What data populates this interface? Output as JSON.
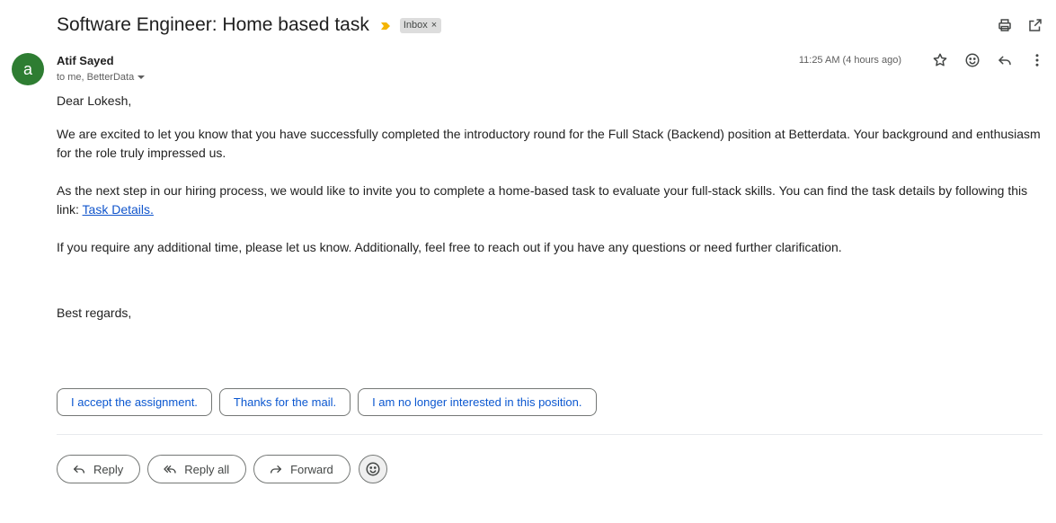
{
  "email": {
    "subject": "Software Engineer: Home based task",
    "label": "Inbox",
    "sender": {
      "name": "Atif Sayed",
      "avatar_letter": "a",
      "avatar_color": "#2e7d32"
    },
    "recipients": "to me, BetterData",
    "timestamp": "11:25 AM (4 hours ago)",
    "body": {
      "greeting": "Dear Lokesh,",
      "paragraph1": "We are excited to let you know that you have successfully completed the introductory round for the Full Stack (Backend) position at Betterdata. Your background and enthusiasm for the role truly impressed us.",
      "paragraph2_text": "As the next step in our hiring process, we would like to invite you to complete a home-based task to evaluate your full-stack skills. You can find the task details by following this link: ",
      "paragraph2_link": "Task Details.",
      "paragraph3": "If you require any additional time, please let us know. Additionally, feel free to reach out if you have any questions or need further clarification.",
      "closing": "Best regards,"
    }
  },
  "smart_replies": [
    "I accept the assignment.",
    "Thanks for the mail.",
    "I am no longer interested in this position."
  ],
  "actions": {
    "reply": "Reply",
    "reply_all": "Reply all",
    "forward": "Forward"
  },
  "icons": {
    "importance": "importance-marker-icon",
    "print": "print-icon",
    "open_new_window": "open-in-new-window-icon",
    "star": "star-icon",
    "emoji": "emoji-icon",
    "reply": "reply-icon",
    "more": "more-vert-icon",
    "caret": "caret-down-icon"
  },
  "colors": {
    "accent_link": "#1155cc",
    "smart_reply_text": "#0b57d0",
    "importance": "#f4b400",
    "label_chip_bg": "#dddddd"
  }
}
